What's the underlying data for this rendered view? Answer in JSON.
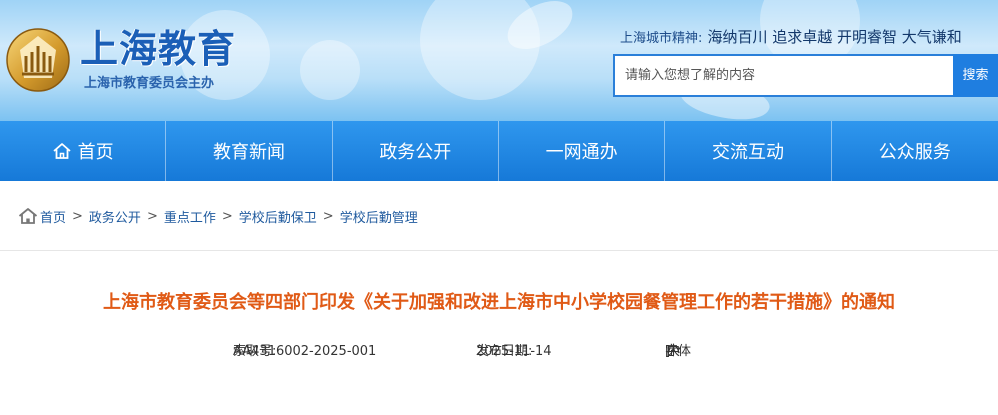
{
  "header": {
    "logo_title": "上海教育",
    "logo_subtitle": "上海市教育委员会主办",
    "city_spirit_label": "上海城市精神:",
    "city_spirit_text": "海纳百川 追求卓越 开明睿智 大气谦和",
    "search_placeholder": "请输入您想了解的内容",
    "search_button": "搜索"
  },
  "nav": {
    "items": [
      {
        "label": "首页",
        "icon": "home-icon"
      },
      {
        "label": "教育新闻"
      },
      {
        "label": "政务公开"
      },
      {
        "label": "一网通办"
      },
      {
        "label": "交流互动"
      },
      {
        "label": "公众服务"
      }
    ]
  },
  "breadcrumb": {
    "icon": "home-icon",
    "items": [
      "首页",
      "政务公开",
      "重点工作",
      "学校后勤保卫",
      "学校后勤管理"
    ],
    "separator": ">"
  },
  "article": {
    "title": "上海市教育委员会等四部门印发《关于加强和改进上海市中小学校园餐管理工作的若干措施》的通知",
    "index_label": "索取号:",
    "index_value": "AA4316002-2025-001",
    "date_label": "发布日期:",
    "date_value": "2025-11-14",
    "font_label": "字体",
    "font_open": "[",
    "font_large": "大",
    "font_medium": "中",
    "font_small": "小",
    "font_close": "]"
  },
  "colors": {
    "brand_blue": "#1679d8",
    "title_orange": "#e05a16",
    "link_blue": "#1f5a9e"
  }
}
